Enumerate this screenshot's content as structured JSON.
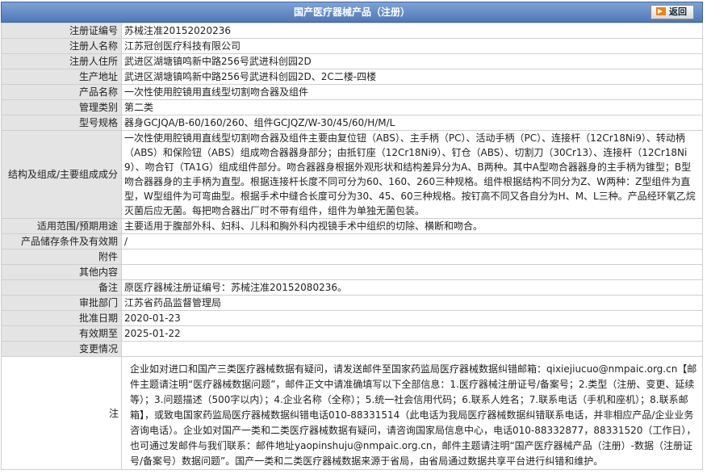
{
  "header": {
    "title": "国产医疗器械产品（注册）",
    "back_label": "返回"
  },
  "fields": {
    "reg_no": {
      "label": "注册证编号",
      "value": "苏械注准20152020236"
    },
    "registrant_name": {
      "label": "注册人名称",
      "value": "江苏冠创医疗科技有限公司"
    },
    "registrant_address": {
      "label": "注册人住所",
      "value": "武进区湖塘镇鸣新中路256号武进科创园2D"
    },
    "production_address": {
      "label": "生产地址",
      "value": "武进区湖塘镇鸣新中路256号武进科创园2D、2C二楼-四楼"
    },
    "product_name": {
      "label": "产品名称",
      "value": "一次性使用腔镜用直线型切割吻合器及组件"
    },
    "mgmt_class": {
      "label": "管理类别",
      "value": "第二类"
    },
    "model_spec": {
      "label": "型号规格",
      "value": "器身GCJQA/B-60/160/260、组件GCJQZ/W-30/45/60/H/M/L"
    },
    "structure": {
      "label": "结构及组成/主要组成成分",
      "value": "一次性使用腔镜用直线型切割吻合器及组件主要由复位钮（ABS）、主手柄（PC）、活动手柄（PC）、连接杆（12Cr18Ni9）、转动柄（ABS）和保险钮（ABS）组成吻合器器身部分；由抵钉座（12Cr18Ni9）、钉仓（ABS）、切割刀（30Cr13）、连接杆（12Cr18Ni9）、吻合钉（TA1G）组成组件部分。吻合器器身根据外观形状和结构差异分为A、B两种。其中A型吻合器器身的主手柄为锥型；B型吻合器器身的主手柄为直型。根据连接杆长度不同可分为60、160、260三种规格。组件根据结构不同分为Z、W两种：Z型组件为直型，W型组件为可弯曲型。根据手术中缝合长度可分为30、45、60三种规格。按钉高不同又各自分为H、M、L三种。产品经环氧乙烷灭菌后应无菌。每把吻合器出厂时不带有组件，组件为单独无菌包装。"
    },
    "scope": {
      "label": "适用范围/预期用途",
      "value": "主要适用于腹部外科、妇科、儿科和胸外科内视镜手术中组织的切除、横断和吻合。"
    },
    "storage": {
      "label": "产品储存条件及有效期",
      "value": "/"
    },
    "attachment": {
      "label": "附件",
      "value": ""
    },
    "other": {
      "label": "其他内容",
      "value": ""
    },
    "remark": {
      "label": "备注",
      "value": "原医疗器械注册证编号：苏械注准20152080236。"
    },
    "approval_dept": {
      "label": "审批部门",
      "value": "江苏省药品监督管理局"
    },
    "approval_date": {
      "label": "批准日期",
      "value": "2020-01-23"
    },
    "valid_until": {
      "label": "有效期至",
      "value": "2025-01-22"
    },
    "changes": {
      "label": "变更情况",
      "value": ""
    },
    "note": {
      "label": "注",
      "value": "企业如对进口和国产三类医疗器械数据有疑问，请发送邮件至国家药监局医疗器械数据纠错邮箱：qixiejiucuo@nmpaic.org.cn【邮件主题请注明“医疗器械数据问题”，邮件正文中请准确填写以下全部信息：1.医疗器械注册证号/备案号；2.类型（注册、变更、延续等）；3.问题描述（500字以内）；4.企业名称（全称）；5.统一社会信用代码；6.联系人姓名；7.联系电话（手机和座机）；8.联系邮箱】，或致电国家药监局医疗器械数据纠错电话010-88331514（此电话为我局医疗器械数据纠错联系电话，并非相应产品/企业业务咨询电话）。企业如对国产一类和二类医疗器械数据有疑问，请咨询国家局信息中心，电话010-88332877，88331520（工作日），也可通过发邮件与我们联系：邮件地址yaopinshuju@nmpaic.org.cn，邮件主题请注明“国产医疗器械产品（注册）-数据（注册证号/备案号）数据问题”。国产一类和二类医疗器械数据来源于省局，由省局通过数据共享平台进行纠错和维护。"
    }
  }
}
